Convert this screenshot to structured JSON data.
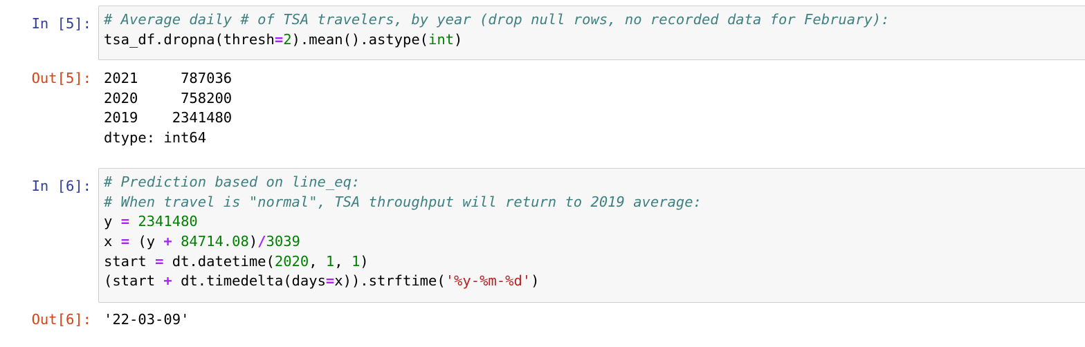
{
  "cell5": {
    "in_prompt": "In [5]:",
    "comment": "# Average daily # of TSA travelers, by year (drop null rows, no recorded data for February):",
    "code": {
      "call_prefix": "tsa_df.dropna(thresh",
      "eq": "=",
      "thresh_value": "2",
      "call_middle": ").mean().astype(",
      "dtype_builtin": "int",
      "call_suffix": ")"
    },
    "out_prompt": "Out[5]:",
    "output_lines": [
      "2021     787036",
      "2020     758200",
      "2019    2341480",
      "dtype: int64"
    ]
  },
  "cell6": {
    "in_prompt": "In [6]:",
    "comments": [
      "# Prediction based on line_eq:",
      "# When travel is \"normal\", TSA throughput will return to 2019 average:"
    ],
    "code": {
      "y_var": "y ",
      "y_eq": "=",
      "y_value": "2341480",
      "x_var": "x ",
      "x_eq": "=",
      "x_open": " (y ",
      "plus": "+",
      "x_offset": "84714.08",
      "x_close": ")",
      "div": "/",
      "x_divisor": "3039",
      "start_var": "start ",
      "start_eq": "=",
      "start_call": " dt.datetime(",
      "start_year": "2020",
      "sep1": ", ",
      "start_month": "1",
      "sep2": ", ",
      "start_day": "1",
      "start_close": ")",
      "last_open": "(start ",
      "last_plus": "+",
      "last_call": " dt.timedelta(days",
      "last_eq": "=",
      "last_mid": "x)).strftime(",
      "fmt_string": "'%y-%m-%d'",
      "last_close": ")"
    },
    "out_prompt": "Out[6]:",
    "output": "'22-03-09'"
  }
}
